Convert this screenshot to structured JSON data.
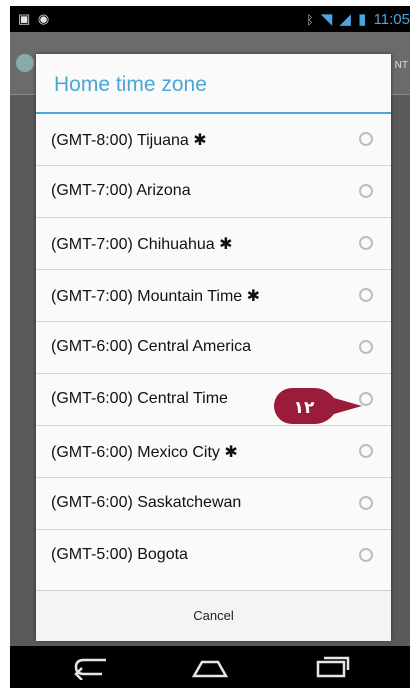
{
  "status_bar": {
    "time": "11:05"
  },
  "background": {
    "strip_text": "NT"
  },
  "dialog": {
    "title": "Home time zone",
    "options": [
      {
        "label": "(GMT-8:00) Tijuana",
        "dst": true
      },
      {
        "label": "(GMT-7:00) Arizona",
        "dst": false
      },
      {
        "label": "(GMT-7:00) Chihuahua",
        "dst": true
      },
      {
        "label": "(GMT-7:00) Mountain Time",
        "dst": true
      },
      {
        "label": "(GMT-6:00) Central America",
        "dst": false
      },
      {
        "label": "(GMT-6:00) Central Time",
        "dst": false
      },
      {
        "label": "(GMT-6:00) Mexico City",
        "dst": true
      },
      {
        "label": "(GMT-6:00) Saskatchewan",
        "dst": false
      },
      {
        "label": "(GMT-5:00) Bogota",
        "dst": false
      }
    ],
    "cancel_label": "Cancel",
    "dst_symbol": "✱"
  },
  "callout": {
    "number": "۱۲",
    "color": "#9b1b3a"
  },
  "colors": {
    "accent": "#4aa6d6",
    "status_time": "#49a6e0"
  },
  "icons": {
    "status_left": [
      "image-icon",
      "gamepad-icon"
    ],
    "status_right": [
      "bluetooth-icon",
      "wifi-icon",
      "signal-icon",
      "battery-icon"
    ],
    "nav": [
      "back-icon",
      "home-icon",
      "recent-apps-icon"
    ]
  }
}
